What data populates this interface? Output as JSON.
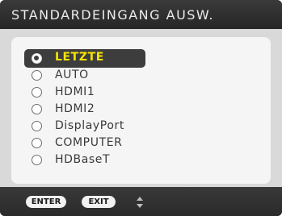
{
  "window": {
    "title": "STANDARDEINGANG AUSW."
  },
  "inputs": [
    {
      "label": "LETZTE",
      "selected": true
    },
    {
      "label": "AUTO",
      "selected": false
    },
    {
      "label": "HDMI1",
      "selected": false
    },
    {
      "label": "HDMI2",
      "selected": false
    },
    {
      "label": "DisplayPort",
      "selected": false
    },
    {
      "label": "COMPUTER",
      "selected": false
    },
    {
      "label": "HDBaseT",
      "selected": false
    }
  ],
  "footer": {
    "enter_label": "ENTER",
    "exit_label": "EXIT",
    "updown_icon": "up-down-arrows-icon"
  },
  "colors": {
    "selected_text": "#f7e400",
    "selected_bg": "#3d3d3d",
    "panel_bg": "#d9d9d9",
    "frame_bg": "#2b2b2b"
  }
}
